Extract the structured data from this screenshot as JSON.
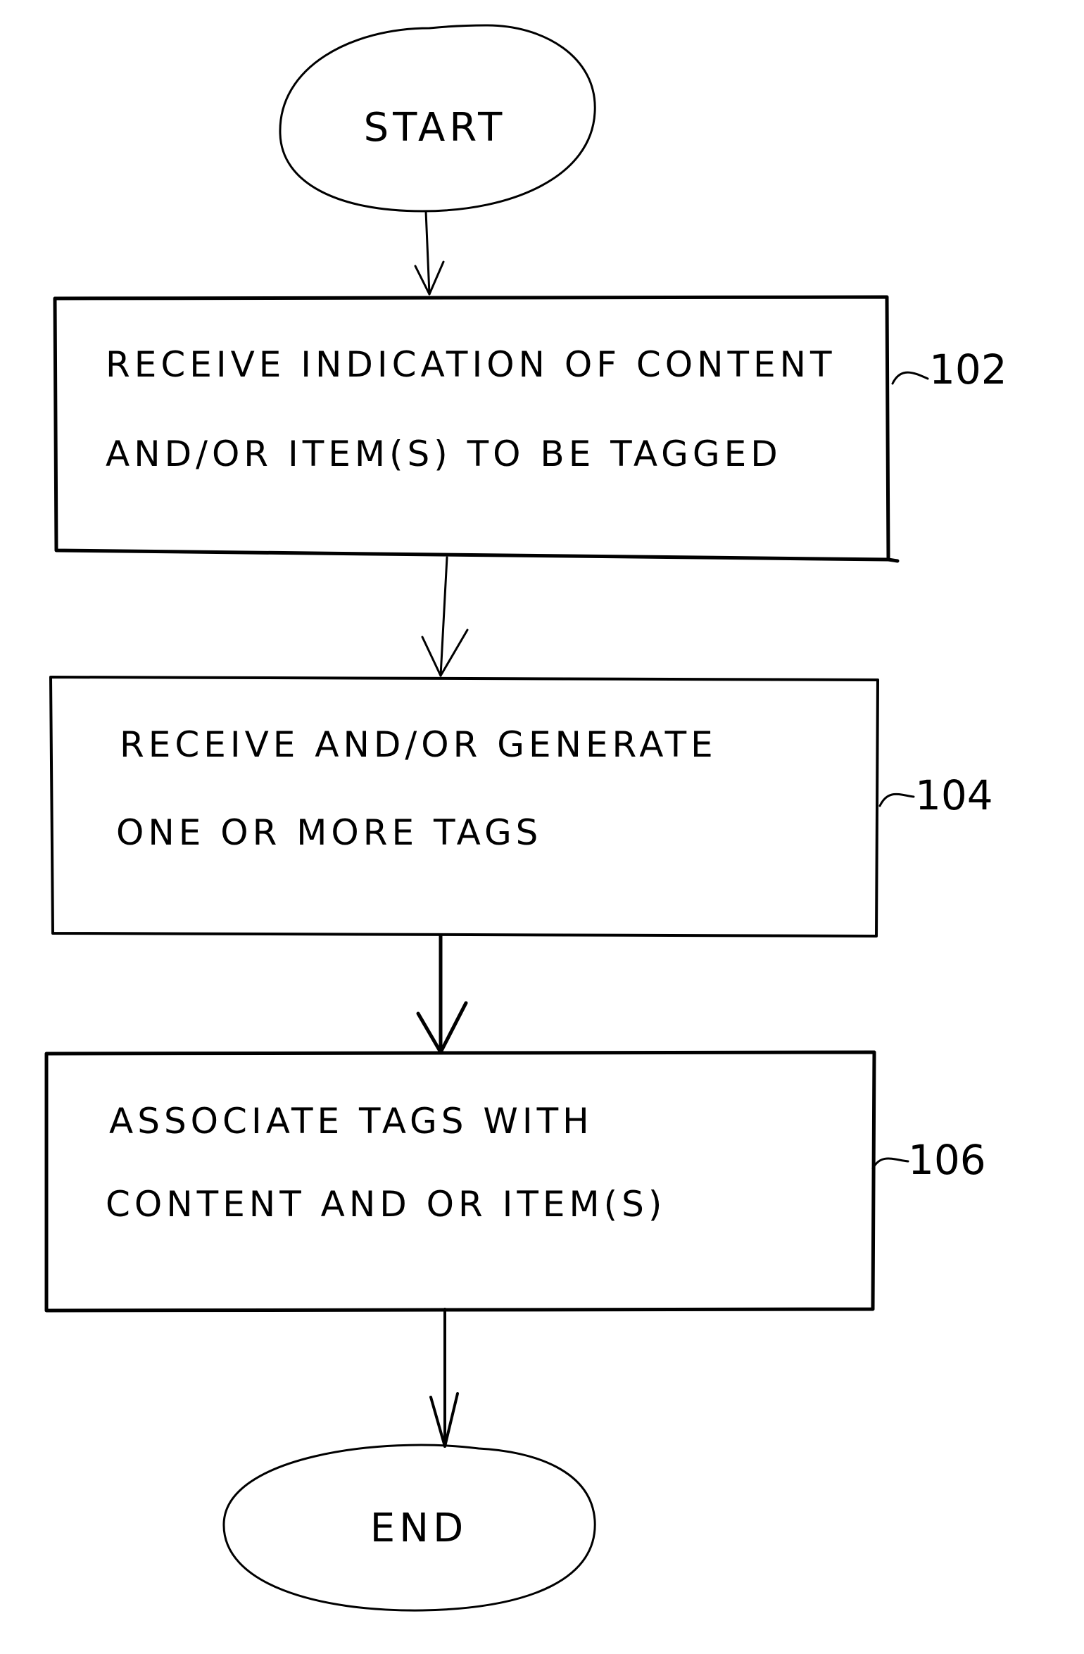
{
  "diagram": {
    "type": "flowchart",
    "nodes": [
      {
        "id": "start",
        "shape": "oval",
        "lines": [
          "START"
        ]
      },
      {
        "id": "step102",
        "shape": "rect",
        "ref": "102",
        "lines": [
          "RECEIVE INDICATION OF CONTENT",
          "AND/OR ITEM(S) TO BE TAGGED"
        ]
      },
      {
        "id": "step104",
        "shape": "rect",
        "ref": "104",
        "lines": [
          "RECEIVE AND/OR GENERATE",
          "ONE OR MORE TAGS"
        ]
      },
      {
        "id": "step106",
        "shape": "rect",
        "ref": "106",
        "lines": [
          "ASSOCIATE TAGS WITH",
          "CONTENT AND OR ITEM(S)"
        ]
      },
      {
        "id": "end",
        "shape": "oval",
        "lines": [
          "END"
        ]
      }
    ],
    "edges": [
      {
        "from": "start",
        "to": "step102"
      },
      {
        "from": "step102",
        "to": "step104"
      },
      {
        "from": "step104",
        "to": "step106"
      },
      {
        "from": "step106",
        "to": "end"
      }
    ]
  }
}
